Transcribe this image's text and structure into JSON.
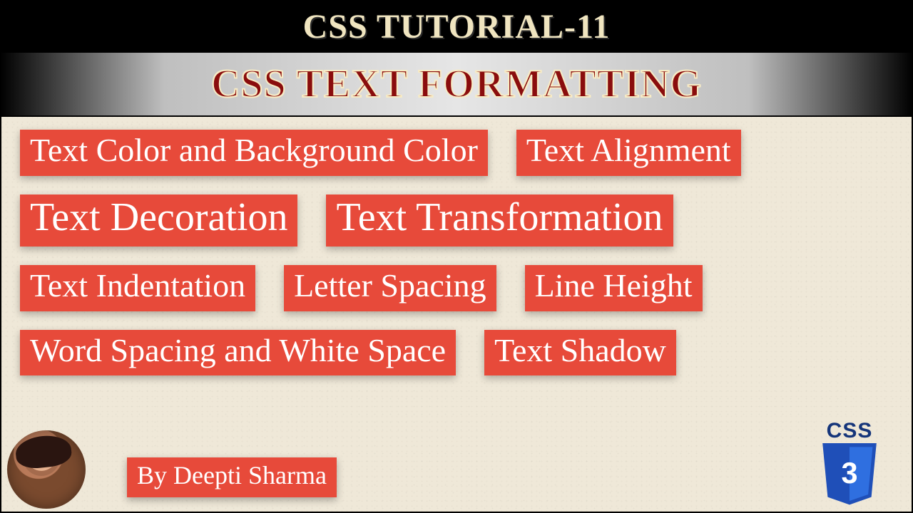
{
  "header": {
    "title": "CSS TUTORIAL-11",
    "subtitle": "CSS TEXT FORMATTING"
  },
  "topics": {
    "r1a": "Text Color and Background Color",
    "r1b": "Text Alignment",
    "r2a": "Text Decoration",
    "r2b": "Text Transformation",
    "r3a": "Text Indentation",
    "r3b": "Letter Spacing",
    "r3c": "Line Height",
    "r4a": "Word Spacing and White Space",
    "r4b": "Text Shadow"
  },
  "footer": {
    "byline": "By Deepti Sharma",
    "badge_label": "CSS",
    "badge_num": "3"
  },
  "colors": {
    "tag_bg": "#e74a3a",
    "title_fg": "#f0e5c0",
    "subtitle_fg": "#8a0d0d",
    "badge_blue": "#1f4fb8"
  }
}
